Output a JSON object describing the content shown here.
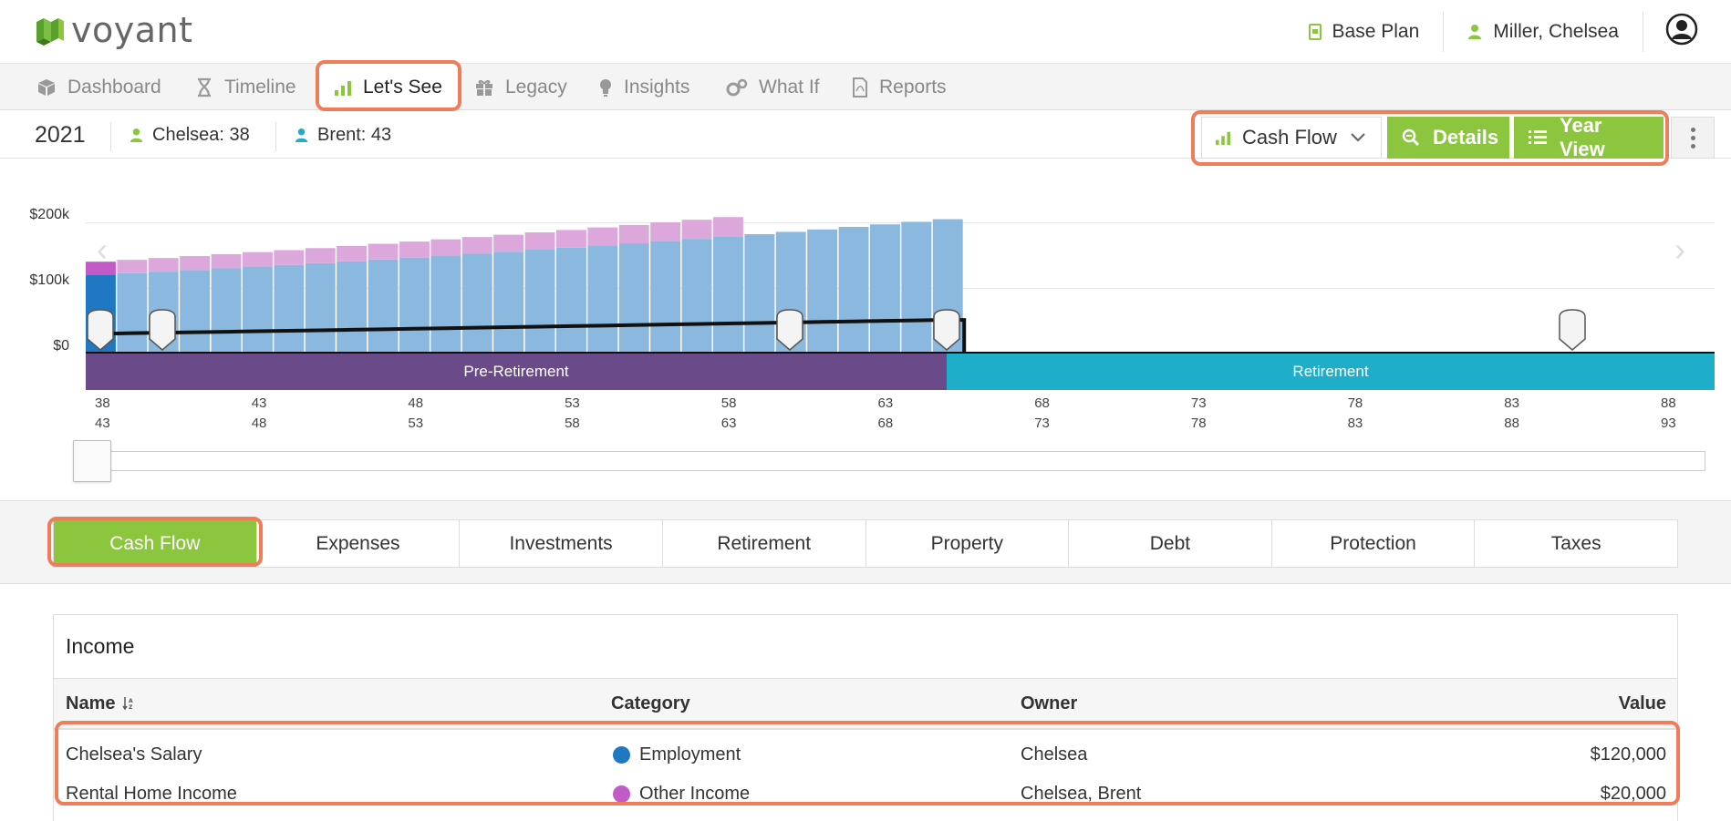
{
  "app": {
    "logo_text": "voyant"
  },
  "header": {
    "plan_label": "Base Plan",
    "client_label": "Miller, Chelsea"
  },
  "nav": {
    "items": [
      {
        "label": "Dashboard",
        "icon": "cube-icon"
      },
      {
        "label": "Timeline",
        "icon": "hourglass-icon"
      },
      {
        "label": "Let's See",
        "icon": "bar-chart-icon",
        "active": true
      },
      {
        "label": "Legacy",
        "icon": "gift-icon"
      },
      {
        "label": "Insights",
        "icon": "lightbulb-icon"
      },
      {
        "label": "What If",
        "icon": "gears-icon"
      },
      {
        "label": "Reports",
        "icon": "pdf-icon"
      }
    ]
  },
  "info": {
    "year": "2021",
    "person1": "Chelsea: 38",
    "person2": "Brent: 43",
    "view_select": "Cash Flow",
    "details_button": "Details",
    "year_view_button": "Year View"
  },
  "colors": {
    "accent": "#8cc63f",
    "pre_retirement": "#6b4a8a",
    "retirement": "#1eaec9",
    "employment": "#1f78c1",
    "other_income": "#c25bc7",
    "highlight": "#f07d5a"
  },
  "chart_data": {
    "type": "bar",
    "yticks": [
      "$200k",
      "$100k",
      "$0"
    ],
    "phases": [
      {
        "label": "Pre-Retirement"
      },
      {
        "label": "Retirement"
      }
    ],
    "age_row_1": [
      "38",
      "43",
      "48",
      "53",
      "58",
      "63",
      "68",
      "73",
      "78",
      "83",
      "88"
    ],
    "age_row_2": [
      "43",
      "48",
      "53",
      "58",
      "63",
      "68",
      "73",
      "78",
      "83",
      "88",
      "93"
    ],
    "x_start_age": 38,
    "ylim": [
      0,
      270000
    ],
    "series": [
      {
        "name": "Employment",
        "color": "#8ab8de",
        "values": [
          120000,
          122400,
          124800,
          127300,
          129900,
          132500,
          135100,
          137800,
          140600,
          143400,
          146300,
          149200,
          152200,
          155200,
          158300,
          161500,
          164700,
          168000,
          171400,
          174800,
          178300,
          181900,
          185500,
          189200,
          193000,
          196900,
          200800,
          204800
        ]
      },
      {
        "name": "Other Income",
        "color": "#dca8dc",
        "values": [
          20000,
          20400,
          20800,
          21200,
          21600,
          22100,
          22500,
          23000,
          23400,
          23900,
          24400,
          24900,
          25400,
          25900,
          26400,
          26900,
          27500,
          28000,
          28600,
          29100,
          29700,
          0,
          0,
          0,
          0,
          0,
          0,
          0
        ]
      }
    ],
    "line_values": [
      30000,
      31000,
      31800,
      32500,
      33200,
      34000,
      34800,
      35500,
      36200,
      37000,
      37800,
      38600,
      39400,
      40200,
      41000,
      41800,
      42600,
      43400,
      44200,
      45000,
      45800,
      46600,
      47400,
      48200,
      49000,
      49800,
      50600,
      51200
    ],
    "first_year_employment": 120000,
    "first_year_other": 20000
  },
  "tabs": [
    "Cash Flow",
    "Expenses",
    "Investments",
    "Retirement",
    "Property",
    "Debt",
    "Protection",
    "Taxes"
  ],
  "income": {
    "title": "Income",
    "columns": {
      "name": "Name",
      "category": "Category",
      "owner": "Owner",
      "value": "Value"
    },
    "rows": [
      {
        "name": "Chelsea's Salary",
        "category": "Employment",
        "owner": "Chelsea",
        "value": "$120,000"
      },
      {
        "name": "Rental Home Income",
        "category": "Other Income",
        "owner": "Chelsea, Brent",
        "value": "$20,000"
      }
    ]
  }
}
